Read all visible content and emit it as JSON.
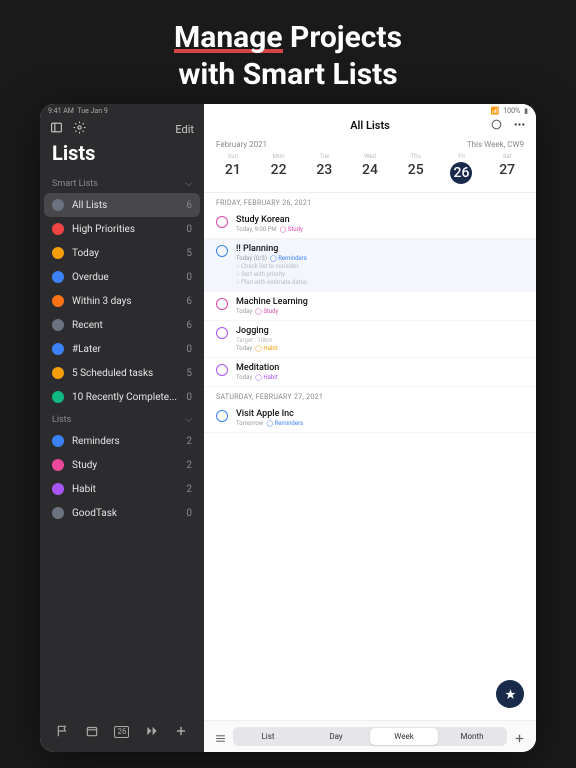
{
  "promo": {
    "line1_hl": "Manage",
    "line1_rest": " Projects",
    "line2": "with Smart Lists"
  },
  "status": {
    "time": "9:41 AM",
    "date": "Tue Jan 9",
    "battery": "100%"
  },
  "sidebar": {
    "edit": "Edit",
    "title": "Lists",
    "sections": [
      {
        "name": "Smart Lists",
        "items": [
          {
            "icon_color": "#6b7280",
            "label": "All Lists",
            "count": 6,
            "active": true
          },
          {
            "icon_color": "#ef4444",
            "label": "High Priorities",
            "count": 0
          },
          {
            "icon_color": "#f59e0b",
            "label": "Today",
            "count": 5
          },
          {
            "icon_color": "#3b82f6",
            "label": "Overdue",
            "count": 0
          },
          {
            "icon_color": "#f97316",
            "label": "Within 3 days",
            "count": 6
          },
          {
            "icon_color": "#6b7280",
            "label": "Recent",
            "count": 6
          },
          {
            "icon_color": "#3b82f6",
            "label": "#Later",
            "count": 0
          },
          {
            "icon_color": "#f59e0b",
            "label": "5 Scheduled tasks",
            "count": 5
          },
          {
            "icon_color": "#10b981",
            "label": "10 Recently Complete...",
            "count": 0
          }
        ]
      },
      {
        "name": "Lists",
        "items": [
          {
            "icon_color": "#3b82f6",
            "label": "Reminders",
            "count": 2
          },
          {
            "icon_color": "#ec4899",
            "label": "Study",
            "count": 2
          },
          {
            "icon_color": "#a855f7",
            "label": "Habit",
            "count": 2
          },
          {
            "icon_color": "#6b7280",
            "label": "GoodTask",
            "count": 0
          }
        ]
      }
    ],
    "bottom_cal": "26"
  },
  "main": {
    "title": "All Lists",
    "month": "February 2021",
    "week_label": "This Week, CW9",
    "days": [
      {
        "dow": "Sun",
        "num": "21"
      },
      {
        "dow": "Mon",
        "num": "22"
      },
      {
        "dow": "Tue",
        "num": "23"
      },
      {
        "dow": "Wed",
        "num": "24"
      },
      {
        "dow": "Thu",
        "num": "25"
      },
      {
        "dow": "Fri",
        "num": "26",
        "today": true
      },
      {
        "dow": "Sat",
        "num": "27"
      }
    ],
    "groups": [
      {
        "date": "FRIDAY, FEBRUARY 26, 2021",
        "tasks": [
          {
            "circ": "pink",
            "title": "Study Korean",
            "meta_time": "Today, 9:00 PM",
            "meta_tag": "Study",
            "tag_class": "tag"
          },
          {
            "circ": "blue",
            "sel": true,
            "title": "!! Planning",
            "meta_time": "Today (0/3)",
            "meta_tag": "Reminders",
            "tag_class": "tag blue",
            "subs": [
              "○ Check list to consider",
              "○ Sort with priority",
              "○ Plan with estimate dates"
            ]
          },
          {
            "circ": "pink",
            "title": "Machine Learning",
            "meta_time": "Today",
            "meta_tag": "Study",
            "tag_class": "tag"
          },
          {
            "circ": "purple",
            "title": "Jogging",
            "meta_time_pre": "Target : 10km",
            "meta_time": "Today",
            "meta_tag": "Habit",
            "tag_class": "tag orange"
          },
          {
            "circ": "purple",
            "title": "Meditation",
            "meta_time": "Today",
            "meta_tag": "Habit",
            "tag_class": "tag purple"
          }
        ]
      },
      {
        "date": "SATURDAY, FEBRUARY 27, 2021",
        "tasks": [
          {
            "circ": "blue",
            "title": "Visit Apple Inc",
            "meta_time": "Tomorrow",
            "meta_tag": "Reminders",
            "tag_class": "tag blue"
          }
        ]
      }
    ],
    "segments": [
      "List",
      "Day",
      "Week",
      "Month"
    ],
    "active_segment": 2
  }
}
